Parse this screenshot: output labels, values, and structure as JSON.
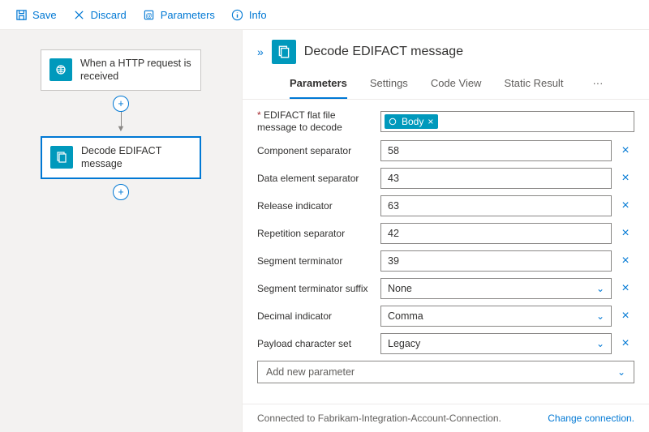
{
  "toolbar": {
    "save": "Save",
    "discard": "Discard",
    "parameters": "Parameters",
    "info": "Info"
  },
  "flow": {
    "node1": "When a HTTP request is received",
    "node2": "Decode EDIFACT message"
  },
  "panel": {
    "title": "Decode EDIFACT message",
    "tabs": {
      "parameters": "Parameters",
      "settings": "Settings",
      "codeview": "Code View",
      "staticresult": "Static Result",
      "more": "···"
    }
  },
  "fields": {
    "flatfile_label": "EDIFACT flat file message to decode",
    "flatfile_token": "Body",
    "componentsep": {
      "label": "Component separator",
      "value": "58"
    },
    "elementsep": {
      "label": "Data element separator",
      "value": "43"
    },
    "release": {
      "label": "Release indicator",
      "value": "63"
    },
    "repetition": {
      "label": "Repetition separator",
      "value": "42"
    },
    "segterm": {
      "label": "Segment terminator",
      "value": "39"
    },
    "segtermsuf": {
      "label": "Segment terminator suffix",
      "value": "None"
    },
    "decimal": {
      "label": "Decimal indicator",
      "value": "Comma"
    },
    "charset": {
      "label": "Payload character set",
      "value": "Legacy"
    }
  },
  "addparam": "Add new parameter",
  "footer": {
    "status": "Connected to Fabrikam-Integration-Account-Connection.",
    "change": "Change connection."
  }
}
